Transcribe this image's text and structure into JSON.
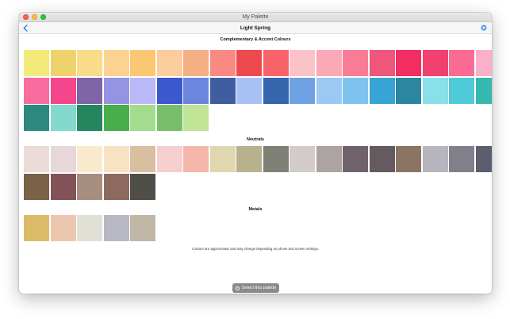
{
  "window": {
    "title": "My Palette"
  },
  "nav": {
    "title": "Light Spring",
    "back_icon": "chevron-left-icon",
    "settings_icon": "gear-icon",
    "accent": "#1b7cf0"
  },
  "sections": [
    {
      "title": "Complementary & Accent Colours",
      "colors": [
        "#f4ea7b",
        "#f0d26d",
        "#f8dc8a",
        "#fbd28f",
        "#fcc772",
        "#fbcc9d",
        "#f4af84",
        "#f98a83",
        "#ee4a4d",
        "#f8636a",
        "#fbc2c8",
        "#fba8b7",
        "#f97c96",
        "#ef567c",
        "#f12d62",
        "#f2416f",
        "#fb6b94",
        "#f9b0c8",
        "#f76e9e",
        "#f5458d",
        "#7f64a8",
        "#9593e3",
        "#bcb9f8",
        "#3b58cc",
        "#6b86dd",
        "#3f5ea2",
        "#a9c0f5",
        "#3465ad",
        "#6ea2e5",
        "#9cc9f3",
        "#7ec3ee",
        "#36a4d4",
        "#2d86a0",
        "#8ae0e9",
        "#4ecad8",
        "#36b8ae",
        "#2d8880",
        "#83dacc",
        "#24855e",
        "#48ae4b",
        "#a3dc8e",
        "#78be6a",
        "#c0e496"
      ]
    },
    {
      "title": "Neutrals",
      "colors": [
        "#ebdcd8",
        "#e8d7d8",
        "#fbe9cd",
        "#f8e2c4",
        "#d9bfa0",
        "#f5cfce",
        "#f7b6ab",
        "#dfd7b0",
        "#b7b18e",
        "#808077",
        "#d3cbc8",
        "#ada4a2",
        "#70626b",
        "#655a5f",
        "#8a7564",
        "#b7b6bf",
        "#817f89",
        "#5b5e6e",
        "#7b6148",
        "#815358",
        "#a88e7e",
        "#8d6a5e",
        "#4f4e48"
      ]
    },
    {
      "title": "Metals",
      "colors": [
        "#dcbb68",
        "#ecc7b0",
        "#e1e0d6",
        "#b7b8c3",
        "#c1b7a6"
      ]
    }
  ],
  "footer": {
    "note": "Colours are approximate and may change depending on phone and screen settings.",
    "select_label": "Select this palette"
  }
}
